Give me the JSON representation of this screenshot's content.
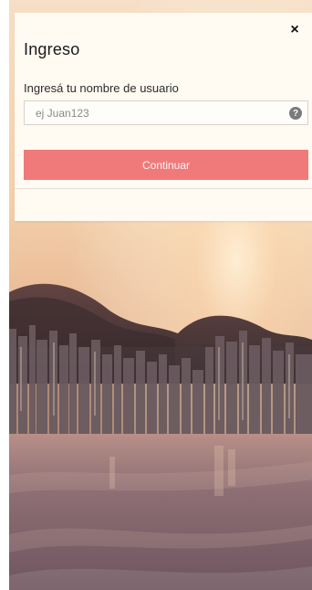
{
  "modal": {
    "close_label": "×",
    "title": "Ingreso",
    "username_label": "Ingresá tu nombre de usuario",
    "username_placeholder": "ej Juan123",
    "help_icon_text": "?",
    "continue_label": "Continuar"
  },
  "colors": {
    "accent": "#f07a7a",
    "modal_bg": "#fffaf2"
  }
}
